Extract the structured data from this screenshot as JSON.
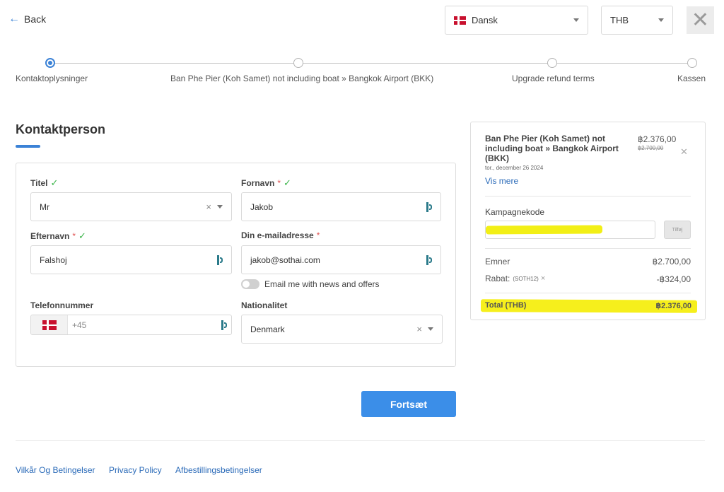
{
  "header": {
    "back_label": "Back",
    "language": {
      "flag": "denmark-flag",
      "value": "Dansk"
    },
    "currency": {
      "value": "THB"
    },
    "close_icon": "close-icon"
  },
  "stepper": {
    "steps": [
      {
        "label": "Kontaktoplysninger",
        "active": true
      },
      {
        "label": "Ban Phe Pier (Koh Samet) not including boat » Bangkok Airport (BKK)",
        "active": false
      },
      {
        "label": "Upgrade refund terms",
        "active": false
      },
      {
        "label": "Kassen",
        "active": false
      }
    ]
  },
  "form": {
    "title": "Kontaktperson",
    "titel": {
      "label": "Titel",
      "value": "Mr"
    },
    "fornavn": {
      "label": "Fornavn",
      "required": "*",
      "value": "Jakob"
    },
    "efternavn": {
      "label": "Efternavn",
      "required": "*",
      "value": "Falshoj"
    },
    "email": {
      "label": "Din e-mailadresse",
      "required": "*",
      "value": "jakob@sothai.com"
    },
    "newsletter_label": "Email me with news and offers",
    "telefon": {
      "label": "Telefonnummer",
      "placeholder": "+45"
    },
    "nationalitet": {
      "label": "Nationalitet",
      "value": "Denmark"
    },
    "continue_label": "Fortsæt"
  },
  "summary": {
    "trip_title": "Ban Phe Pier (Koh Samet) not including boat » Bangkok Airport (BKK)",
    "trip_date": "tor., december 26 2024",
    "price": "฿2.376,00",
    "old_price": "฿2.700,00",
    "vis_mere": "Vis mere",
    "kampagnekode_label": "Kampagnekode",
    "tilfoj_label": "Tilføj",
    "emner_label": "Emner",
    "emner_value": "฿2.700,00",
    "rabat_label": "Rabat:",
    "rabat_code": "(SOTH12)",
    "rabat_value": "-฿324,00",
    "total_label": "Total (THB)",
    "total_value": "฿2.376,00"
  },
  "footer": {
    "links": [
      "Vilkår Og Betingelser",
      "Privacy Policy",
      "Afbestillingsbetingelser"
    ]
  },
  "colors": {
    "accent": "#3b82d6",
    "button": "#3b8ee8",
    "highlight": "#f6ef1c",
    "check": "#3cb54a"
  }
}
